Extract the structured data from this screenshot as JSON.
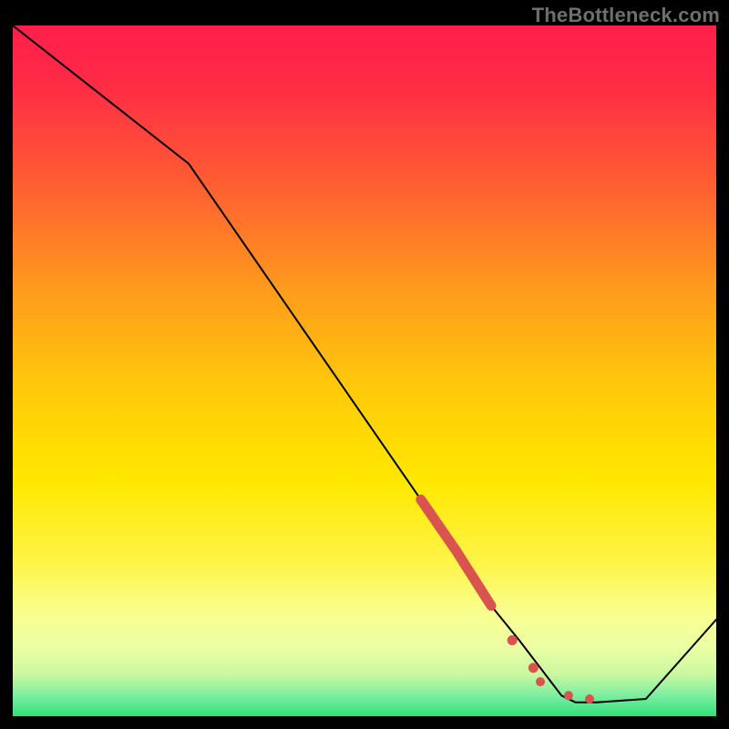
{
  "watermark": "TheBottleneck.com",
  "colors": {
    "frame": "#000000",
    "line": "#000000",
    "marker": "#d9534f",
    "gradient_top": "#ff1744",
    "gradient_mid_upper": "#ffb300",
    "gradient_mid": "#ffe800",
    "gradient_lower": "#f6ff9a",
    "gradient_green": "#2fe07a"
  },
  "chart_data": {
    "type": "line",
    "title": "",
    "xlabel": "",
    "ylabel": "",
    "xlim": [
      0,
      100
    ],
    "ylim": [
      0,
      100
    ],
    "grid": false,
    "series": [
      {
        "name": "bottleneck-curve",
        "x": [
          0,
          25,
          63,
          68,
          72,
          78,
          80,
          83,
          90,
          100
        ],
        "values": [
          100,
          80,
          24,
          16,
          11,
          3,
          2,
          2,
          2.5,
          14
        ]
      }
    ],
    "markers": [
      {
        "name": "highlight-band",
        "kind": "thick-segment",
        "x_range": [
          58,
          68
        ],
        "y_range": [
          30,
          16
        ]
      },
      {
        "name": "highlight-dots",
        "kind": "dots",
        "points": [
          {
            "x": 71,
            "y": 11
          },
          {
            "x": 74,
            "y": 7
          },
          {
            "x": 75,
            "y": 5
          },
          {
            "x": 79,
            "y": 3
          },
          {
            "x": 82,
            "y": 2.5
          }
        ]
      }
    ]
  }
}
